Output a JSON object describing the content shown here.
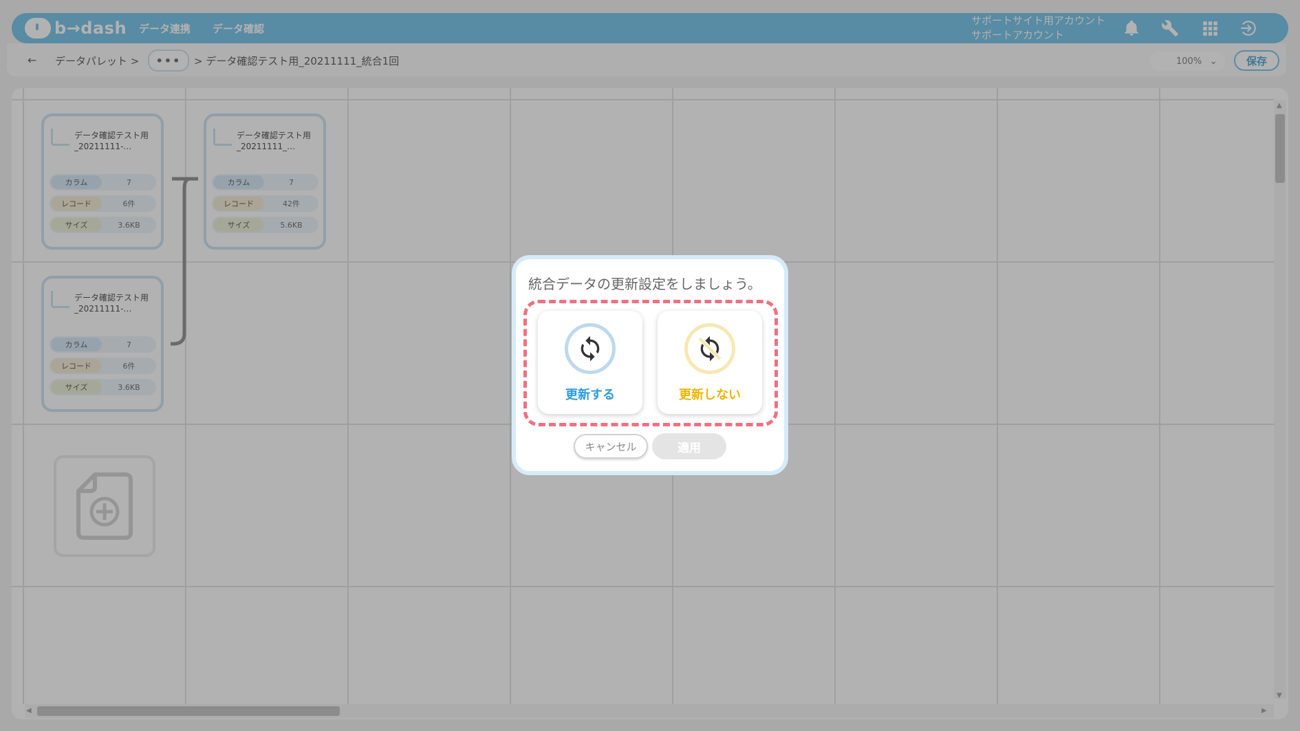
{
  "app": {
    "logo_text": "b→dash"
  },
  "header": {
    "nav": [
      "データ連携",
      "データ確認"
    ],
    "account_line1": "サポートサイト用アカウント",
    "account_line2": "サポートアカウント",
    "icons": [
      "bell-icon",
      "wrench-icon",
      "grid-icon",
      "logout-icon"
    ]
  },
  "toolbar": {
    "back": "←",
    "breadcrumb_root": "データパレット >",
    "ellipsis": "•••",
    "breadcrumb_current": "> データ確認テスト用_20211111_統合1回",
    "zoom_value": "100%",
    "save_label": "保存"
  },
  "cards": [
    {
      "title": "データ確認テスト用_20211111-…",
      "column_label": "カラム",
      "column_value": "7",
      "record_label": "レコード",
      "record_value": "6件",
      "size_label": "サイズ",
      "size_value": "3.6KB"
    },
    {
      "title": "データ確認テスト用_20211111_…",
      "column_label": "カラム",
      "column_value": "7",
      "record_label": "レコード",
      "record_value": "42件",
      "size_label": "サイズ",
      "size_value": "5.6KB"
    },
    {
      "title": "データ確認テスト用_20211111-…",
      "column_label": "カラム",
      "column_value": "7",
      "record_label": "レコード",
      "record_value": "6件",
      "size_label": "サイズ",
      "size_value": "3.6KB"
    }
  ],
  "dialog": {
    "title": "統合データの更新設定をしましょう。",
    "option_update": "更新する",
    "option_no_update": "更新しない",
    "cancel_label": "キャンセル",
    "apply_label": "適用"
  },
  "colors": {
    "brand": "#7ec7eb",
    "update": "#2d9be0",
    "no_update": "#f0b400",
    "highlight": "#f07080"
  }
}
